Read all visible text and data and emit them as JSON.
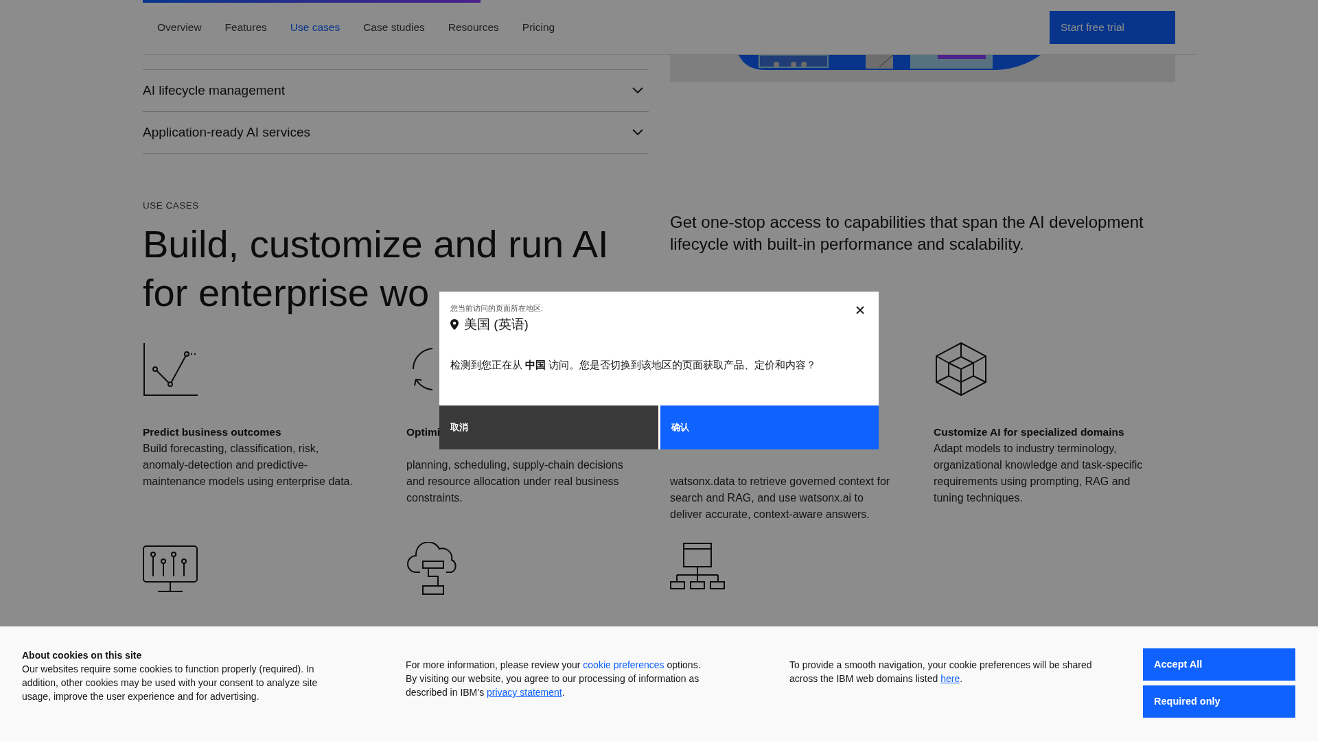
{
  "nav": {
    "items": [
      {
        "label": "Overview",
        "selected": false
      },
      {
        "label": "Features",
        "selected": false
      },
      {
        "label": "Use cases",
        "selected": true
      },
      {
        "label": "Case studies",
        "selected": false
      },
      {
        "label": "Resources",
        "selected": false
      },
      {
        "label": "Pricing",
        "selected": false
      }
    ],
    "cta": "Start free trial"
  },
  "scroll_progress": {
    "level": 0.327
  },
  "accordion": [
    {
      "label": "AI lifecycle management",
      "expanded": false
    },
    {
      "label": "Application-ready AI services",
      "expanded": false
    }
  ],
  "use_cases": {
    "eyebrow": "USE CASES",
    "heading": [
      "Build, customize and run AI",
      "for enterprise wo"
    ],
    "intro": "Get one-stop access to capabilities that span the AI development lifecycle with built-in performance and scalability.",
    "cards": [
      {
        "kind": "chart",
        "title": "Predict business outcomes",
        "text": "Build forecasting, classification, risk, anomaly-detection and predictive-maintenance models using enterprise data."
      },
      {
        "kind": "cycle",
        "title": "Optimi",
        "text": "planning, scheduling, supply-chain decisions and resource allocation under real business constraints."
      },
      {
        "kind": "none",
        "text": "watsonx.data to retrieve governed context for search and RAG, and use watsonx.ai to deliver accurate, context-aware answers."
      },
      {
        "kind": "cube",
        "title": "Customize AI for specialized domains",
        "text": "Adapt models to industry terminology, organizational knowledge and task-specific requirements using prompting, RAG and tuning techniques."
      },
      {
        "kind": "monitor"
      },
      {
        "kind": "cloud"
      },
      {
        "kind": "network"
      }
    ]
  },
  "region_dialog": {
    "label": "您当前访问的页面所在地区:",
    "location": "美国 (英语)",
    "message": "检测到您正在从 **中国** 访问。您是否切换到该地区的页面获取产品、定价和内容？",
    "buttons": [
      {
        "label": "取消",
        "kind": "secondary"
      },
      {
        "label": "确认",
        "kind": "primary"
      }
    ]
  },
  "cookie_banner": {
    "title": "About cookies on this site",
    "text": "Our websites require some cookies to function properly (required). In addition, other cookies may be used with your consent to analyze site usage, improve the user experience and for advertising.",
    "more": [
      {
        "text": "For more information, please review your ",
        "kind": "text"
      },
      {
        "text": "cookie preferences",
        "kind": "link"
      },
      {
        "text": " options. By visiting our website, you agree to our processing of information as described in IBM’s ",
        "kind": "text"
      },
      {
        "text": "privacy statement",
        "kind": "underlined"
      },
      {
        "text": ".",
        "kind": "text"
      }
    ],
    "shared": [
      {
        "text": "To provide a smooth navigation, your cookie preferences will be shared across the IBM web domains listed ",
        "kind": "text"
      },
      {
        "text": "here",
        "kind": "underlined"
      },
      {
        "text": ".",
        "kind": "text"
      }
    ],
    "buttons": [
      "Accept All",
      "Required only"
    ]
  }
}
